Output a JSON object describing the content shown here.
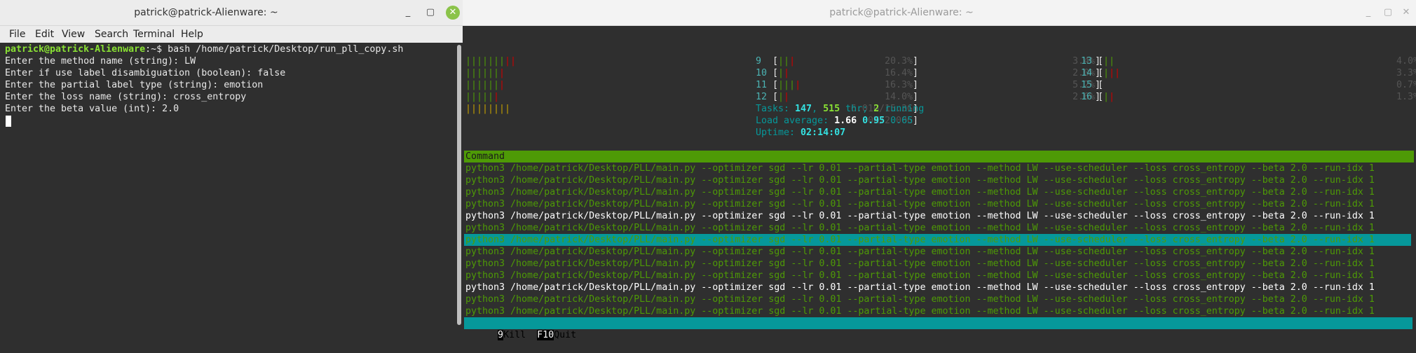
{
  "left_window": {
    "title": "patrick@patrick-Alienware: ~",
    "controls": {
      "minimize": "_",
      "maximize": "▢",
      "close": "✕"
    },
    "menu": [
      "File",
      "Edit",
      "View",
      "Search",
      "Terminal",
      "Help"
    ],
    "terminal": {
      "prompt": "patrick@patrick-Alienware",
      "prompt_suffix": ":~$ ",
      "command": "bash /home/patrick/Desktop/run_pll_copy.sh",
      "lines": [
        "Enter the method name (string): LW",
        "Enter if use label disambiguation (boolean): false",
        "Enter the partial label type (string): emotion",
        "Enter the loss name (string): cross_entropy",
        "Enter the beta value (int): 2.0"
      ]
    }
  },
  "right_window": {
    "title": "patrick@patrick-Alienware: ~",
    "controls": {
      "minimize": "_",
      "maximize": "▢",
      "close": "✕"
    },
    "htop": {
      "cpu_left": [
        {
          "bar_g": "|||||||",
          "bar_r": "||",
          "pct": "20.3%"
        },
        {
          "bar_g": "||||||",
          "bar_r": "|",
          "pct": "16.4%"
        },
        {
          "bar_g": "||||||",
          "bar_r": "|",
          "pct": "16.3%"
        },
        {
          "bar_g": "|||||",
          "bar_r": "|",
          "pct": "14.0%"
        }
      ],
      "mem": {
        "bar": "||||||||",
        "text": "6.01G/15.3G"
      },
      "swp": {
        "text": "0K/2.00G"
      },
      "cpu_mid": [
        {
          "num": "9",
          "bar_g": "||",
          "bar_r": "|",
          "pct": "3.4%"
        },
        {
          "num": "10",
          "bar_g": "|",
          "bar_r": "|",
          "pct": "2.0%"
        },
        {
          "num": "11",
          "bar_g": "|||",
          "bar_r": "|",
          "pct": "5.2%"
        },
        {
          "num": "12",
          "bar_g": "|",
          "bar_r": "|",
          "pct": "2.6%"
        }
      ],
      "cpu_right": [
        {
          "num": "13",
          "bar_g": "||",
          "bar_r": "",
          "pct": "4.0%"
        },
        {
          "num": "14",
          "bar_g": "|",
          "bar_r": "||",
          "pct": "3.3%"
        },
        {
          "num": "15",
          "bar_g": "",
          "bar_r": "",
          "pct": "0.7%"
        },
        {
          "num": "16",
          "bar_g": "|",
          "bar_r": "|",
          "pct": "1.3%"
        }
      ],
      "tasks": {
        "label": "Tasks: ",
        "count": "147",
        "sep": ", ",
        "threads": "515",
        "thr_label": " thr; ",
        "running": "2",
        "running_label": " running"
      },
      "load": {
        "label": "Load average: ",
        "one": "1.66",
        "five": "0.95",
        "fifteen": "0.65"
      },
      "uptime": {
        "label": "Uptime: ",
        "value": "02:14:07"
      },
      "column_header": "Command",
      "process_command": "python3 /home/patrick/Desktop/PLL/main.py --optimizer sgd --lr 0.01 --partial-type emotion --method LW --use-scheduler --loss cross_entropy --beta 2.0 --run-idx 1",
      "process_styles": [
        "green",
        "green",
        "green",
        "green",
        "white",
        "green",
        "selected",
        "green",
        "green",
        "green",
        "white",
        "green",
        "green"
      ],
      "footer": [
        {
          "key": "9",
          "label": "Kill  "
        },
        {
          "key": "F10",
          "label": "Quit"
        }
      ]
    }
  },
  "colors": {
    "terminal_bg": "#2f2f2f",
    "prompt": "#8ae234",
    "htop_header_bg": "#4e9a06",
    "htop_selected_bg": "#06989a"
  }
}
